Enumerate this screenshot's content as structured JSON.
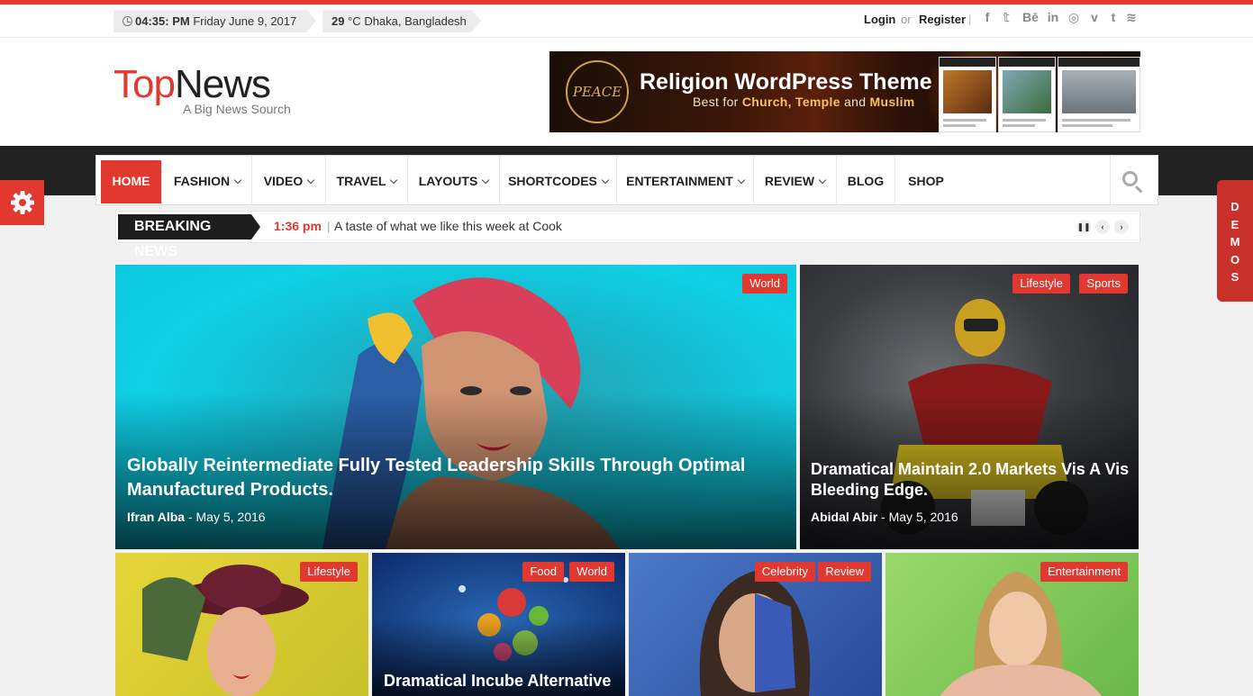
{
  "topbar": {
    "time": "04:35: PM",
    "date": "Friday June 9, 2017",
    "temp": "29",
    "temp_unit": "°C",
    "location": "Dhaka, Bangladesh",
    "login": "Login",
    "or": "or",
    "register": "Register",
    "divider": "|",
    "social": [
      {
        "icon": "facebook-icon",
        "glyph": "f"
      },
      {
        "icon": "twitter-icon",
        "glyph": "𝕥"
      },
      {
        "icon": "behance-icon",
        "glyph": "Bē"
      },
      {
        "icon": "linkedin-icon",
        "glyph": "in"
      },
      {
        "icon": "instagram-icon",
        "glyph": "◎"
      },
      {
        "icon": "vimeo-icon",
        "glyph": "v"
      },
      {
        "icon": "tumblr-icon",
        "glyph": "t"
      },
      {
        "icon": "rss-icon",
        "glyph": "≋"
      }
    ]
  },
  "logo": {
    "part1": "Top",
    "part2": "News",
    "tagline": "A Big News Sourch"
  },
  "banner": {
    "seal": "PEACE",
    "title": "Religion WordPress Theme",
    "subtitle_prefix": "Best for",
    "subtitle_highlight": "Church, Temple",
    "subtitle_and": "and",
    "subtitle_end": "Muslim"
  },
  "nav": {
    "items": [
      {
        "label": "HOME",
        "dropdown": false
      },
      {
        "label": "FASHION",
        "dropdown": true
      },
      {
        "label": "VIDEO",
        "dropdown": true
      },
      {
        "label": "TRAVEL",
        "dropdown": true
      },
      {
        "label": "LAYOUTS",
        "dropdown": true
      },
      {
        "label": "SHORTCODES",
        "dropdown": true
      },
      {
        "label": "ENTERTAINMENT",
        "dropdown": true
      },
      {
        "label": "REVIEW",
        "dropdown": true
      },
      {
        "label": "BLOG",
        "dropdown": false
      },
      {
        "label": "SHOP",
        "dropdown": false
      }
    ]
  },
  "demos": {
    "letters": [
      "D",
      "E",
      "M",
      "O",
      "S"
    ]
  },
  "breaking": {
    "label": "BREAKING NEWS",
    "time": "1:36 pm",
    "divider": "|",
    "headline": "A taste of what we like this week at Cook"
  },
  "posts": {
    "main": {
      "tags": [
        "World"
      ],
      "title": "Globally Reintermediate Fully Tested Leadership Skills Through Optimal Manufactured Products.",
      "author": "Ifran Alba",
      "date": "May 5, 2016"
    },
    "side": {
      "tags": [
        "Lifestyle",
        "Sports"
      ],
      "title": "Dramatical Maintain 2.0 Markets Vis A Vis Bleeding Edge.",
      "author": "Abidal Abir",
      "date": "May 5, 2016"
    },
    "small": [
      {
        "tags": [
          "Lifestyle"
        ],
        "title": ""
      },
      {
        "tags": [
          "Food",
          "World"
        ],
        "title": "Dramatical Incube Alternative"
      },
      {
        "tags": [
          "Celebrity",
          "Review"
        ],
        "title": ""
      },
      {
        "tags": [
          "Entertainment"
        ],
        "title": ""
      }
    ]
  },
  "colors": {
    "accent": "#e2382f",
    "dark": "#222222"
  }
}
